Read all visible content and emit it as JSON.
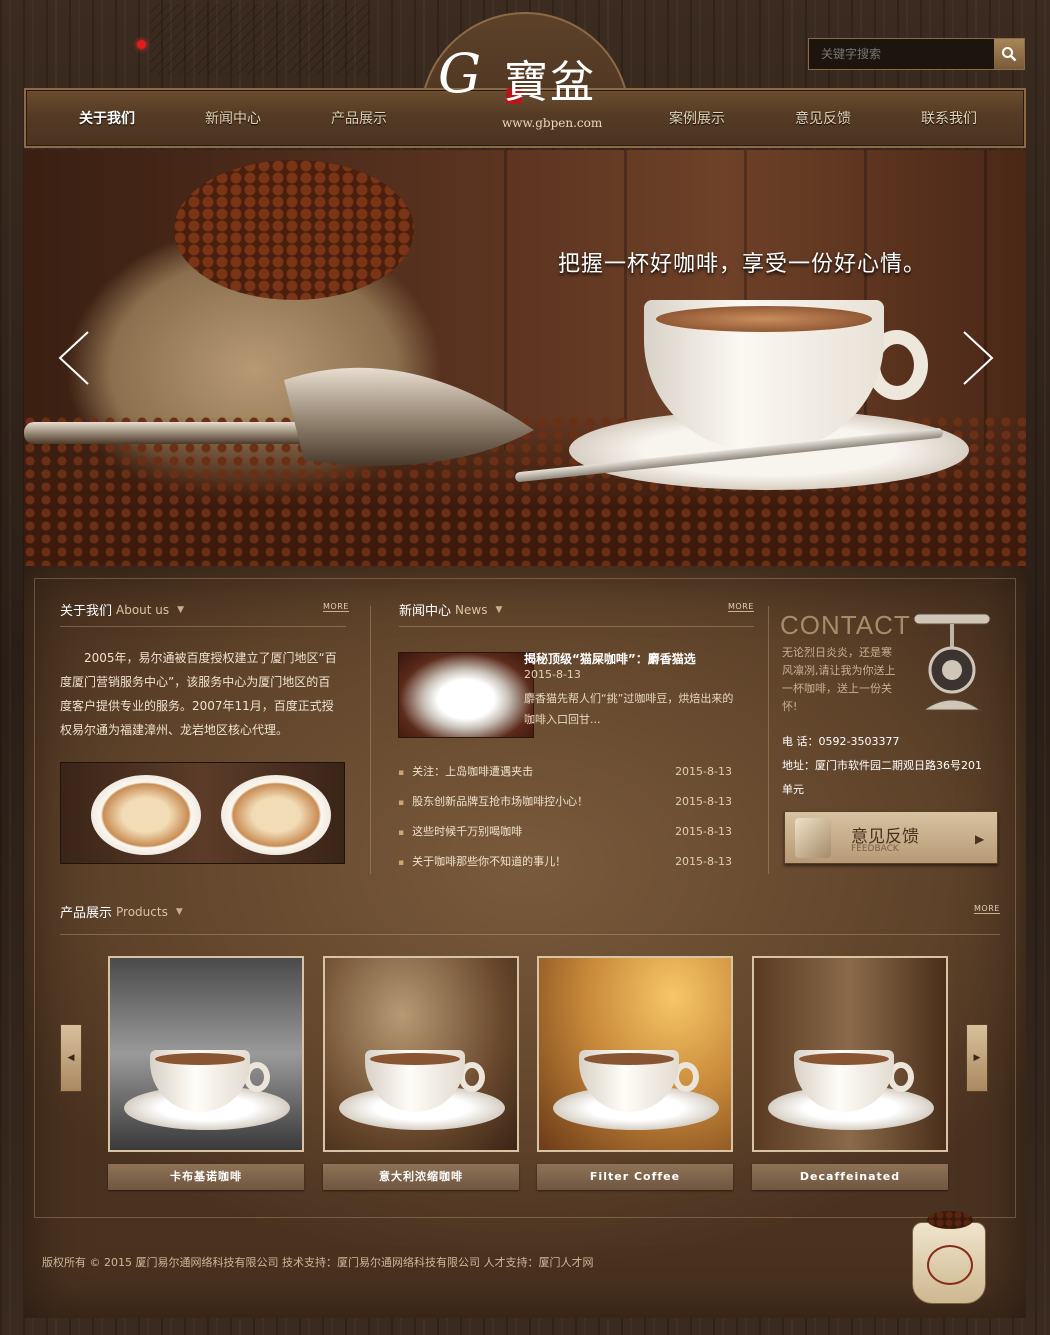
{
  "search": {
    "placeholder": "关键字搜索"
  },
  "logo": {
    "letter": "G",
    "name": "寶盆",
    "url": "www.gbpen.com"
  },
  "nav": {
    "items": [
      {
        "label": "关于我们",
        "active": true
      },
      {
        "label": "新闻中心",
        "active": false
      },
      {
        "label": "产品展示",
        "active": false
      },
      {
        "label": "案例展示",
        "active": false
      },
      {
        "label": "意见反馈",
        "active": false
      },
      {
        "label": "联系我们",
        "active": false
      }
    ]
  },
  "banner": {
    "slogan": "把握一杯好咖啡，享受一份好心情。"
  },
  "about": {
    "title": "关于我们",
    "title_en": "About us",
    "more": "MORE",
    "text": "2005年，易尔通被百度授权建立了厦门地区“百度厦门营销服务中心”，该服务中心为厦门地区的百度客户提供专业的服务。2007年11月，百度正式授权易尔通为福建漳州、龙岩地区核心代理。"
  },
  "news": {
    "title": "新闻中心",
    "title_en": "News",
    "more": "MORE",
    "featured": {
      "headline": "揭秘顶级“猫屎咖啡”：麝香猫选",
      "date": "2015-8-13",
      "summary": "麝香猫先帮人们“挑”过咖啡豆，烘焙出来的咖啡入口回甘..."
    },
    "items": [
      {
        "title": "关注：上岛咖啡遭遇夹击",
        "date": "2015-8-13"
      },
      {
        "title": "股东创新品牌互抢市场咖啡控小心！",
        "date": "2015-8-13"
      },
      {
        "title": "这些时候千万别喝咖啡",
        "date": "2015-8-13"
      },
      {
        "title": "关于咖啡那些你不知道的事儿！",
        "date": "2015-8-13"
      }
    ]
  },
  "contact": {
    "title": "CONTACT",
    "text": "无论烈日炎炎，还是寒风凛冽,请让我为你送上一杯咖啡，送上一份关怀!",
    "phone": "电  话：0592-3503377",
    "address_line1": "地址：厦门市软件园二期观日路36号201",
    "address_line2": "单元",
    "feedback_cn": "意见反馈",
    "feedback_en": "FEEDBACK"
  },
  "products": {
    "title": "产品展示",
    "title_en": "Products",
    "more": "MORE",
    "items": [
      {
        "label": "卡布基诺咖啡"
      },
      {
        "label": "意大利浓缩咖啡"
      },
      {
        "label": "Filter Coffee"
      },
      {
        "label": "Decaffeinated"
      }
    ]
  },
  "footer": {
    "text": "版权所有 © 2015 厦门易尔通网络科技有限公司   技术支持：厦门易尔通网络科技有限公司  人才支持：厦门人才网"
  },
  "colors": {
    "accent": "#8c6a45",
    "bg": "#2a1e16",
    "panel": "#6e5034"
  }
}
